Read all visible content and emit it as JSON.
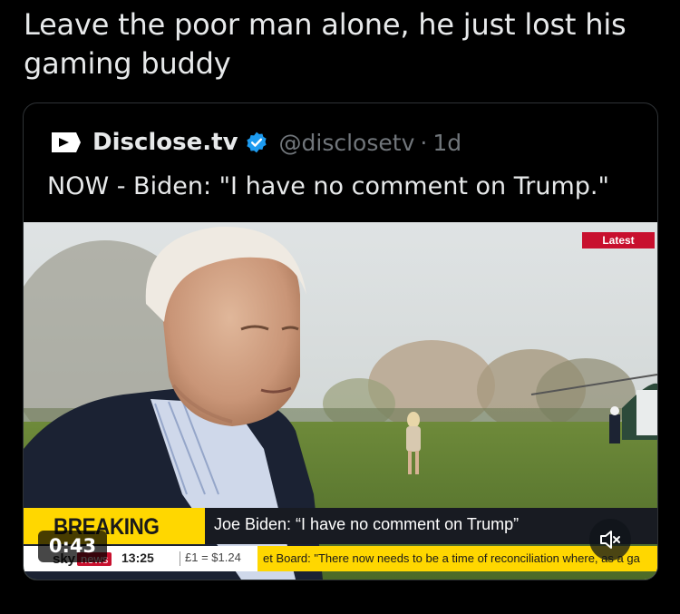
{
  "post": {
    "text": "Leave the poor man alone, he just lost his gaming buddy"
  },
  "quoted": {
    "display_name": "Disclose.tv",
    "verified": true,
    "handle": "@disclosetv",
    "separator": "·",
    "time": "1d",
    "text": "NOW - Biden: \"I have no comment on Trump.\"",
    "logo_icon": "disclose-tv-logo-icon",
    "verified_icon": "verified-badge-icon"
  },
  "media": {
    "latest_tag": "Latest",
    "breaking_label": "BREAKING NEWS",
    "headline": "Joe Biden: “I have no comment on Trump”",
    "channel_sky": "sky",
    "channel_news": "news",
    "clock": "13:25",
    "fx_rate": "£1 = $1.24",
    "crawl": "et Board: \"There now needs to be a time of reconciliation where, as a ga",
    "duration": "0:43",
    "mute_icon": "muted-speaker-icon"
  },
  "colors": {
    "background": "#000000",
    "text": "#e7e9ea",
    "muted": "#71767b",
    "verified": "#1d9bf0",
    "breaking_yellow": "#ffd700",
    "sky_red": "#c8102e"
  }
}
